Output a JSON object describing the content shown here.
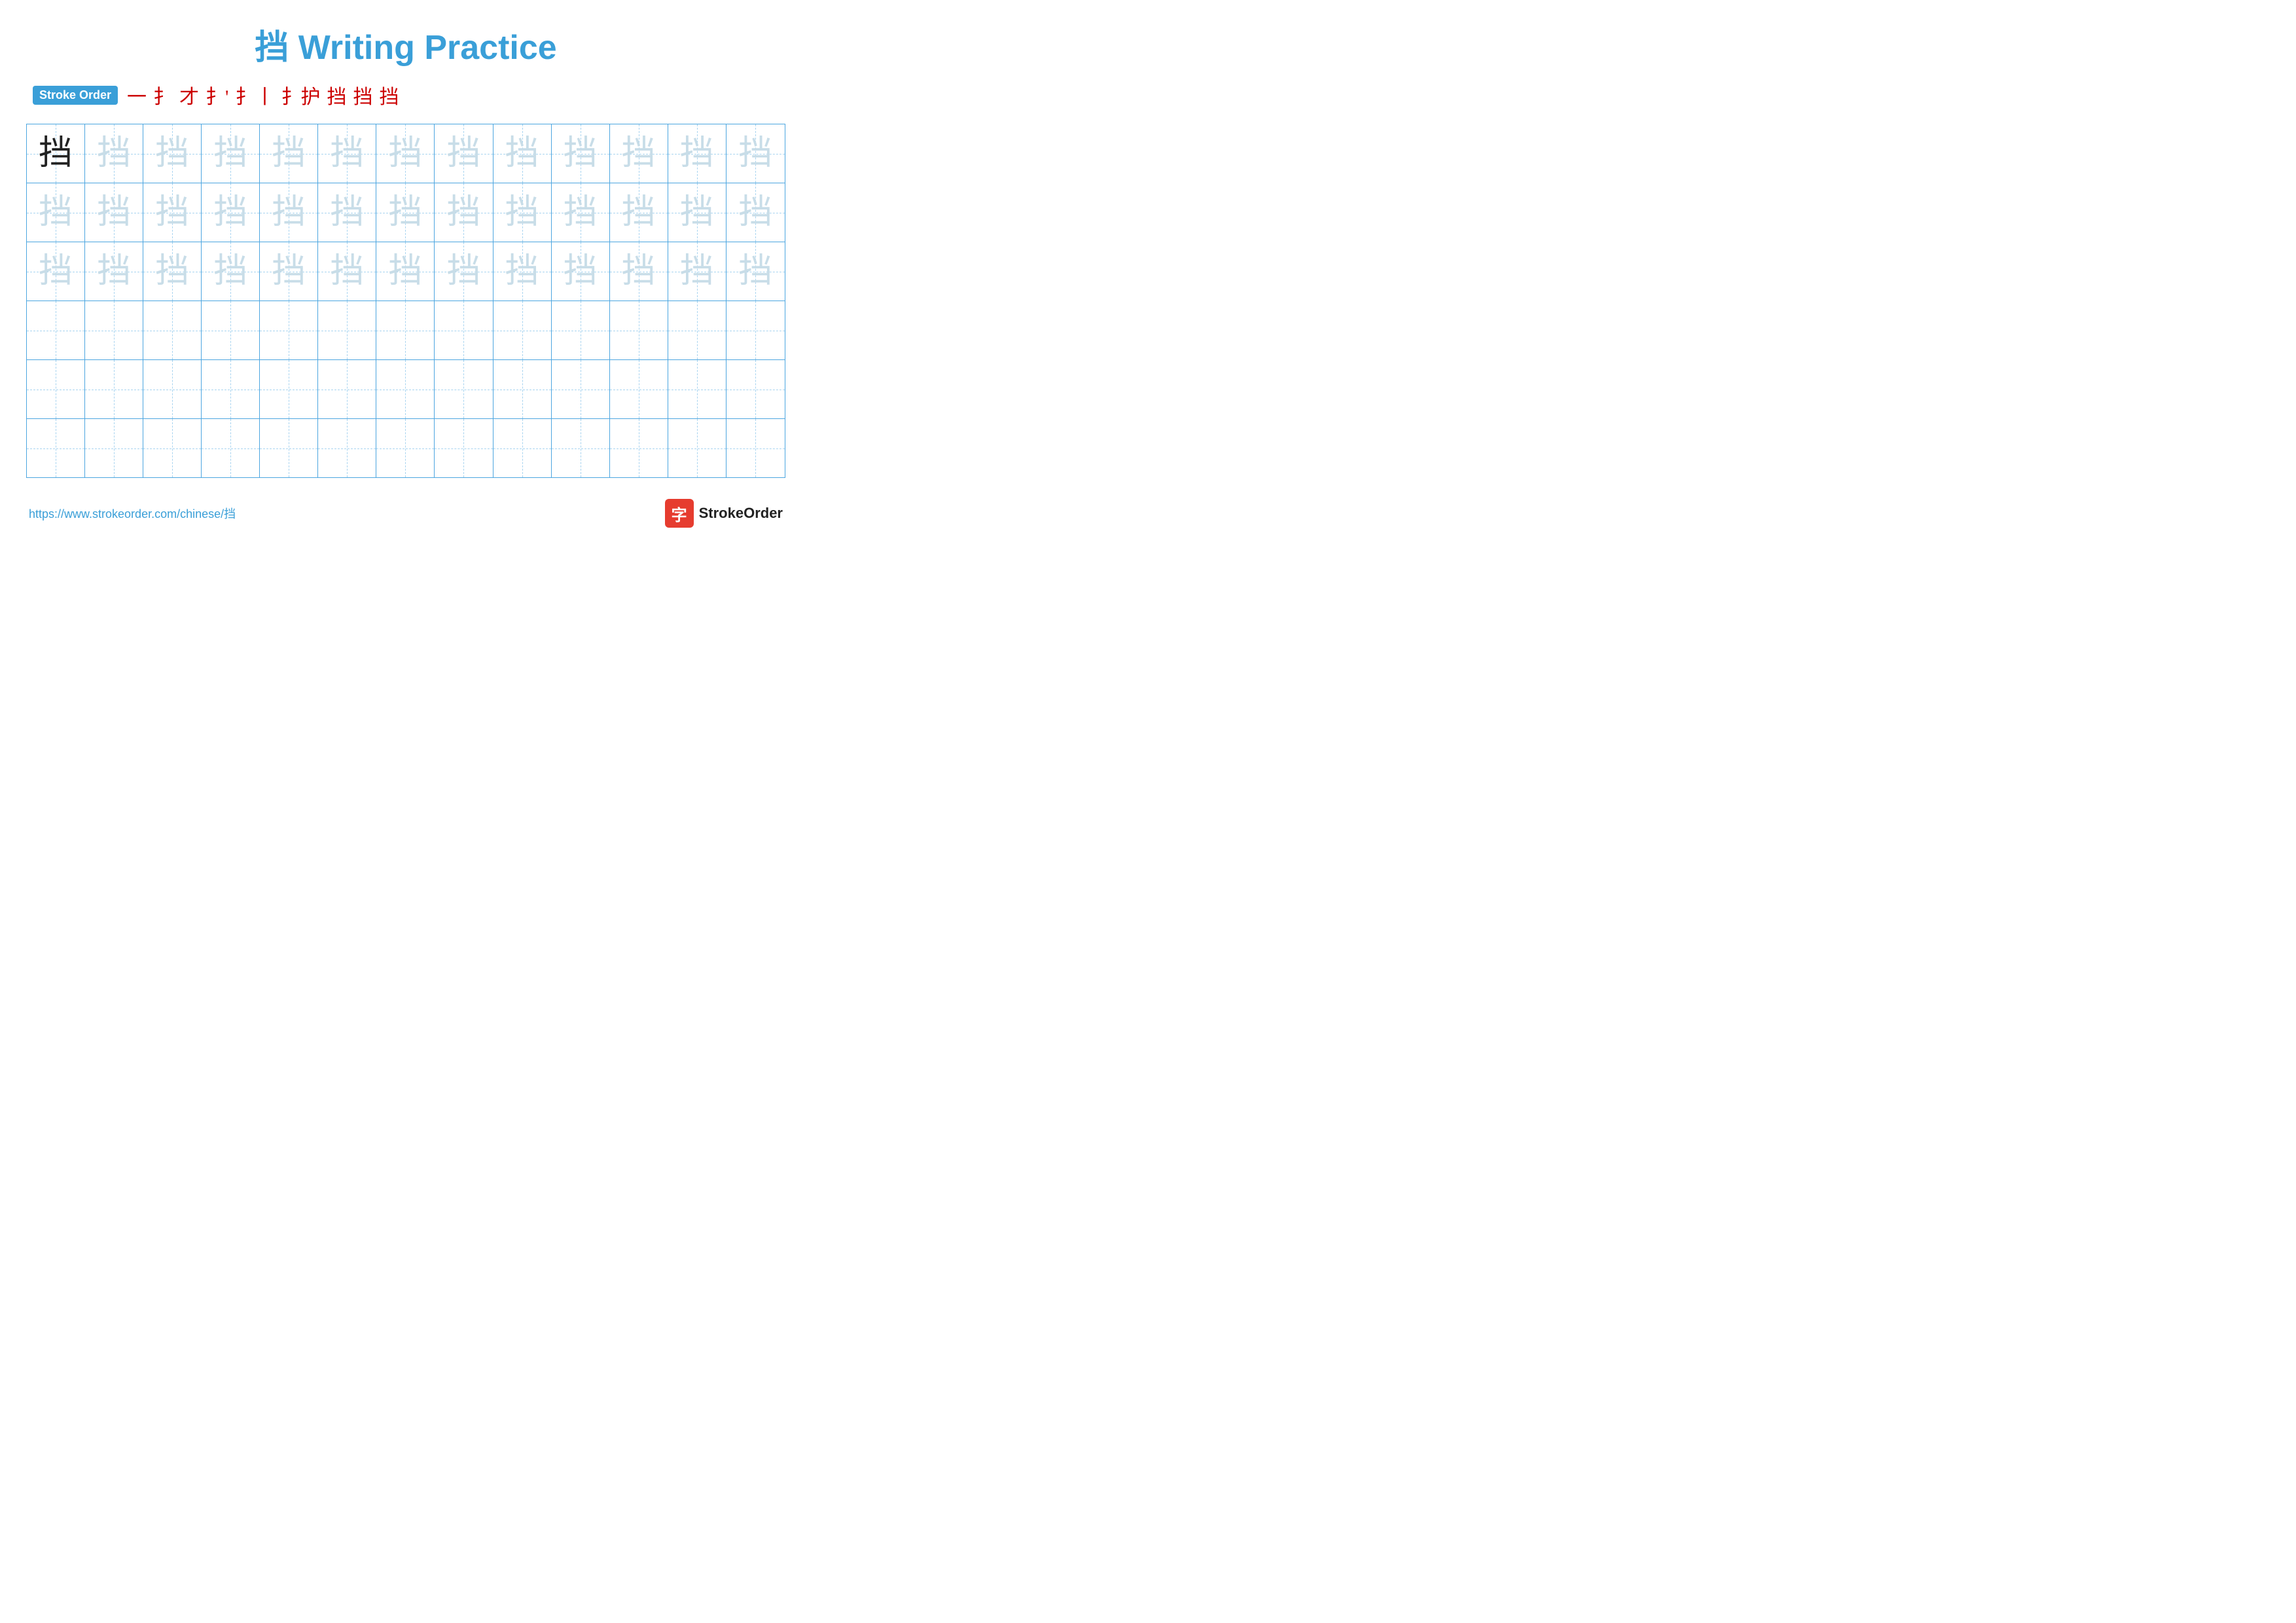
{
  "title": {
    "text": "挡 Writing Practice",
    "char": "挡"
  },
  "stroke_order": {
    "badge_label": "Stroke Order",
    "strokes": [
      "一",
      "扌",
      "才",
      "扌'",
      "扌丨",
      "扌丨'",
      "挡",
      "挡",
      "挡"
    ]
  },
  "grid": {
    "rows": 6,
    "cols": 13,
    "char": "挡",
    "row_types": [
      "dark_first_light_rest",
      "light_all",
      "light_all",
      "empty",
      "empty",
      "empty"
    ]
  },
  "footer": {
    "url": "https://www.strokeorder.com/chinese/挡",
    "logo_text": "StrokeOrder",
    "logo_icon": "字"
  }
}
